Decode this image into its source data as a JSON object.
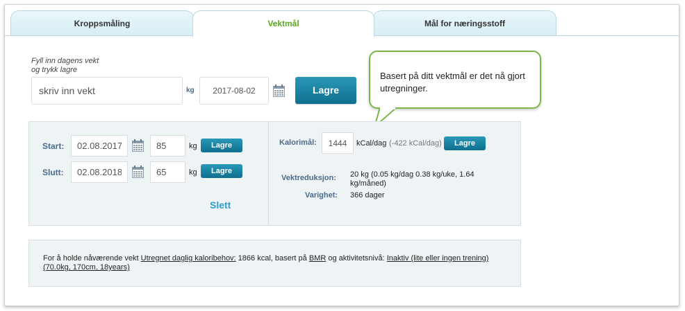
{
  "tabs": [
    {
      "label": "Kroppsmåling",
      "active": false
    },
    {
      "label": "Vektmål",
      "active": true
    },
    {
      "label": "Mål for næringsstoff",
      "active": false
    }
  ],
  "entry": {
    "hint_line1": "Fyll inn dagens vekt",
    "hint_line2": "og trykk lagre",
    "weight_placeholder": "skriv inn vekt",
    "unit": "kg",
    "date_value": "2017-08-02",
    "save_label": "Lagre"
  },
  "tooltip": {
    "text": "Basert på ditt vektmål er det nå gjort utregninger."
  },
  "goal": {
    "start_label": "Start:",
    "start_date": "02.08.2017",
    "start_weight": "85",
    "end_label": "Slutt:",
    "end_date": "02.08.2018",
    "end_weight": "65",
    "unit": "kg",
    "save_label": "Lagre",
    "delete_label": "Slett"
  },
  "calories": {
    "label": "Kalorimål:",
    "value": "1444",
    "unit": "kCal/dag",
    "delta": "(-422 kCal/dag)",
    "save_label": "Lagre",
    "reduction_label": "Vektreduksjon:",
    "reduction_line1": "20 kg (0.05 kg/dag 0.38 kg/uke, 1.64",
    "reduction_line2": "kg/måned)",
    "duration_label": "Varighet:",
    "duration_value": "366 dager"
  },
  "info": {
    "prefix": "For å holde nåværende vekt ",
    "link_calorie": "Utregnet daglig kaloribehov:",
    "mid1": " 1866 kcal, basert på ",
    "link_bmr": "BMR",
    "mid2": " og aktivitetsnivå: ",
    "link_activity": "Inaktiv (lite eller ingen trening)",
    "link_stats": "(70.0kg, 170cm, 18years)"
  },
  "colors": {
    "accent_green": "#5aaa1e",
    "button_blue": "#1a82a3",
    "label_blue": "#4a6b8a",
    "tooltip_border": "#7ab648"
  }
}
